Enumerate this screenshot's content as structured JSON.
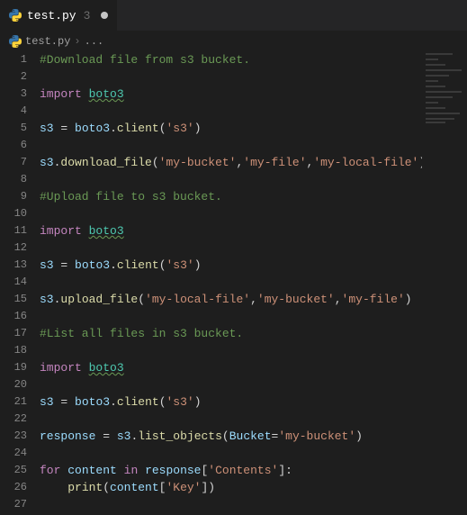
{
  "tab": {
    "filename": "test.py",
    "num": "3",
    "dirty": true
  },
  "breadcrumb": {
    "filename": "test.py",
    "sep": "›",
    "more": "..."
  },
  "code": {
    "lines": [
      {
        "n": 1,
        "type": "comment",
        "text": "#Download file from s3 bucket."
      },
      {
        "n": 2,
        "type": "blank"
      },
      {
        "n": 3,
        "type": "import",
        "kw": "import",
        "mod": "boto3"
      },
      {
        "n": 4,
        "type": "blank"
      },
      {
        "n": 5,
        "type": "assign-call",
        "var": "s3",
        "obj": "boto3",
        "method": "client",
        "args": [
          "'s3'"
        ]
      },
      {
        "n": 6,
        "type": "blank"
      },
      {
        "n": 7,
        "type": "call",
        "obj": "s3",
        "method": "download_file",
        "args": [
          "'my-bucket'",
          "'my-file'",
          "'my-local-file'"
        ]
      },
      {
        "n": 8,
        "type": "blank"
      },
      {
        "n": 9,
        "type": "comment",
        "text": "#Upload file to s3 bucket."
      },
      {
        "n": 10,
        "type": "blank"
      },
      {
        "n": 11,
        "type": "import",
        "kw": "import",
        "mod": "boto3"
      },
      {
        "n": 12,
        "type": "blank"
      },
      {
        "n": 13,
        "type": "assign-call",
        "var": "s3",
        "obj": "boto3",
        "method": "client",
        "args": [
          "'s3'"
        ]
      },
      {
        "n": 14,
        "type": "blank"
      },
      {
        "n": 15,
        "type": "call",
        "obj": "s3",
        "method": "upload_file",
        "args": [
          "'my-local-file'",
          "'my-bucket'",
          "'my-file'"
        ]
      },
      {
        "n": 16,
        "type": "blank"
      },
      {
        "n": 17,
        "type": "comment",
        "text": "#List all files in s3 bucket."
      },
      {
        "n": 18,
        "type": "blank"
      },
      {
        "n": 19,
        "type": "import",
        "kw": "import",
        "mod": "boto3"
      },
      {
        "n": 20,
        "type": "blank"
      },
      {
        "n": 21,
        "type": "assign-call",
        "var": "s3",
        "obj": "boto3",
        "method": "client",
        "args": [
          "'s3'"
        ]
      },
      {
        "n": 22,
        "type": "blank"
      },
      {
        "n": 23,
        "type": "assign-kwcall",
        "var": "response",
        "obj": "s3",
        "method": "list_objects",
        "kwarg": "Bucket",
        "kwval": "'my-bucket'"
      },
      {
        "n": 24,
        "type": "blank"
      },
      {
        "n": 25,
        "type": "for",
        "kw1": "for",
        "var": "content",
        "kw2": "in",
        "iter": "response",
        "key": "'Contents'"
      },
      {
        "n": 26,
        "type": "print",
        "indent": 1,
        "func": "print",
        "obj": "content",
        "key": "'Key'"
      },
      {
        "n": 27,
        "type": "blank"
      }
    ]
  }
}
